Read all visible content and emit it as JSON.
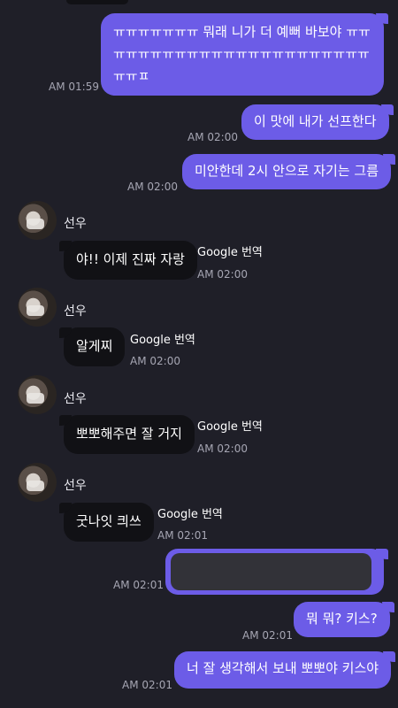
{
  "colors": {
    "background": "#1f1f28",
    "outgoing_bubble": "#6c5ce7",
    "incoming_bubble": "#111115",
    "timestamp": "#a6a6b3"
  },
  "header_remnant": {
    "time": "AM 01:59"
  },
  "messages": [
    {
      "direction": "out",
      "text": "ㅠㅠㅠㅠㅠㅠㅠ 뭐래 니가 더 예뻐 바보야 ㅠㅠ ㅠㅠㅠㅠㅠㅠㅠㅠㅠㅠㅠㅠㅠㅠㅠㅠㅠㅠㅠㅠㅠ ㅠㅠㅍ",
      "time": "AM 01:59"
    },
    {
      "direction": "out",
      "text": "이 맛에 내가 선프한다",
      "time": "AM 02:00"
    },
    {
      "direction": "out",
      "text": "미안한데 2시 안으로 자기는 그름",
      "time": "AM 02:00"
    },
    {
      "direction": "in",
      "sender": "선우",
      "text": "야!! 이제 진짜 자랑",
      "translate": "Google 번역",
      "time": "AM 02:00"
    },
    {
      "direction": "in",
      "sender": "선우",
      "text": "알게찌",
      "translate": "Google 번역",
      "time": "AM 02:00"
    },
    {
      "direction": "in",
      "sender": "선우",
      "text": "뽀뽀해주면 잘 거지",
      "translate": "Google 번역",
      "time": "AM 02:00"
    },
    {
      "direction": "in",
      "sender": "선우",
      "text": "굿나잇 킈쓰",
      "translate": "Google 번역",
      "time": "AM 02:01"
    },
    {
      "direction": "out",
      "text": "",
      "redacted": true,
      "time": "AM 02:01"
    },
    {
      "direction": "out",
      "text": "뭐 뭐? 키스?",
      "time": "AM 02:01"
    },
    {
      "direction": "out",
      "text": "너 잘 생각해서 보내 뽀뽀야 키스야",
      "time": "AM 02:01"
    }
  ]
}
